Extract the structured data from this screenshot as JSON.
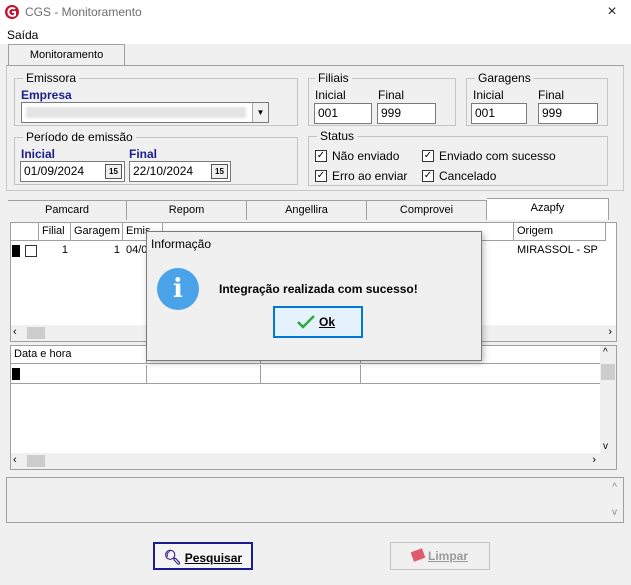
{
  "window": {
    "title": "CGS - Monitoramento",
    "close": "×"
  },
  "menu": {
    "saida": "Saída"
  },
  "tabs": {
    "monitoramento": "Monitoramento"
  },
  "emissora": {
    "group": "Emissora",
    "empresa_label": "Empresa",
    "empresa_value": ""
  },
  "periodo": {
    "group": "Período de emissão",
    "inicial_label": "Inicial",
    "inicial_value": "01/09/2024",
    "final_label": "Final",
    "final_value": "22/10/2024",
    "cal_icon": "15"
  },
  "filiais": {
    "group": "Filiais",
    "inicial_label": "Inicial",
    "inicial_value": "001",
    "final_label": "Final",
    "final_value": "999"
  },
  "garagens": {
    "group": "Garagens",
    "inicial_label": "Inicial",
    "inicial_value": "001",
    "final_label": "Final",
    "final_value": "999"
  },
  "status": {
    "group": "Status",
    "nao_enviado": "Não enviado",
    "enviado_sucesso": "Enviado com sucesso",
    "erro_enviar": "Erro ao enviar",
    "cancelado": "Cancelado",
    "check": "✓"
  },
  "integration_tabs": [
    "Pamcard",
    "Repom",
    "Angellira",
    "Comprovei",
    "Azapfy"
  ],
  "grid1": {
    "headers": {
      "filial": "Filial",
      "garagem": "Garagem",
      "emissao": "Emis",
      "origem": "Origem"
    },
    "row": {
      "filial": "1",
      "garagem": "1",
      "emissao": "04/0",
      "origem": "MIRASSOL - SP"
    }
  },
  "grid2": {
    "headers": {
      "data_hora": "Data e hora"
    }
  },
  "buttons": {
    "pesquisar": "Pesquisar",
    "limpar": "Limpar"
  },
  "dialog": {
    "title": "Informação",
    "message": "Integração realizada com sucesso!",
    "ok": "Ok",
    "icon": "i"
  },
  "colors": {
    "accent": "#0078d7",
    "label_blue": "#1c1c8e",
    "info": "#4aa3e8"
  }
}
